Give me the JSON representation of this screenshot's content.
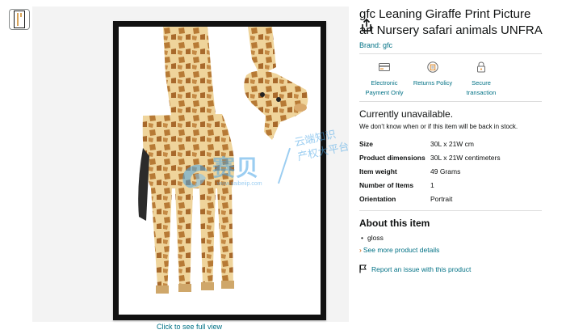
{
  "gallery": {
    "thumbnail_icon": "giraffe-thumbnail",
    "share_icon": "share-icon",
    "full_view_link": "Click to see full view"
  },
  "watermark": {
    "brand": "赛贝",
    "url": "www.saibeiip.com",
    "tagline_line1": "云端知识",
    "tagline_line2": "产权大平台"
  },
  "product": {
    "title": "gfc Leaning Giraffe Print Picture art Nursery safari animals UNFRAMED",
    "title_line1": "gfc Leaning Giraffe Print Picture",
    "title_line2": "art Nursery safari animals UNFRA",
    "brand": "Brand: gfc"
  },
  "features": [
    {
      "icon": "payment-card-icon",
      "line1": "Electronic",
      "line2": "Payment Only"
    },
    {
      "icon": "return-policy-icon",
      "line1": "Returns Policy",
      "line2": ""
    },
    {
      "icon": "secure-lock-icon",
      "line1": "Secure",
      "line2": "transaction"
    }
  ],
  "availability": {
    "status": "Currently unavailable.",
    "note": "We don't know when or if this item will be back in stock."
  },
  "specs": [
    {
      "label": "Size",
      "value": "30L x 21W cm"
    },
    {
      "label": "Product dimensions",
      "value": "30L x 21W centimeters"
    },
    {
      "label": "Item weight",
      "value": "49 Grams"
    },
    {
      "label": "Number of Items",
      "value": "1"
    },
    {
      "label": "Orientation",
      "value": "Portrait"
    }
  ],
  "about": {
    "heading": "About this item",
    "bullets": [
      "gloss"
    ],
    "see_more": "See more product details",
    "report": "Report an issue with this product"
  },
  "colors": {
    "link": "#007185",
    "text": "#0f1111",
    "divider": "#dddddd",
    "watermark": "#4aa6e6"
  }
}
